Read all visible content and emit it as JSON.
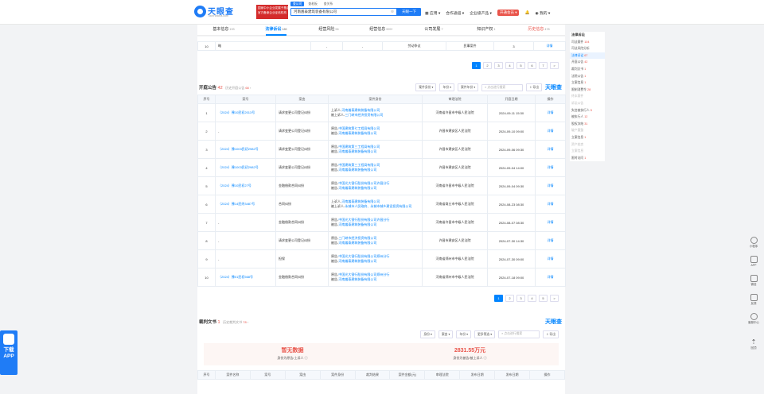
{
  "header": {
    "logo": {
      "cn": "天眼查",
      "en": "TianYancha.com"
    },
    "banner": [
      "国家中小企业发展子基金旗下",
      "官方备案企业征信机构"
    ],
    "search_tabs": [
      "查公司",
      "查老板",
      "查关系"
    ],
    "search_value": "河南嵩泰建筑装备有限公司",
    "search_button": "天眼一下",
    "nav": [
      "应用",
      "合作通道",
      "企业级产品",
      "开通会员",
      "防骗"
    ],
    "user": "我的"
  },
  "tabs": [
    {
      "label": "基本信息",
      "count": "193"
    },
    {
      "label": "法律诉讼",
      "count": "180"
    },
    {
      "label": "经营风险",
      "count": "96"
    },
    {
      "label": "经营信息",
      "count": "999+"
    },
    {
      "label": "公司发展",
      "count": "7"
    },
    {
      "label": "知识产权",
      "count": "1"
    },
    {
      "label": "历史信息",
      "count": "478"
    }
  ],
  "prev_row": {
    "no": "10",
    "c1": "略",
    "c2": "-",
    "c3": "-",
    "c4": "劳动争议",
    "c5": "民事案件",
    "c6": "3",
    "detail": "详情"
  },
  "pager1": [
    "1",
    "2",
    "3",
    "4",
    "5",
    "6",
    "7",
    ">"
  ],
  "kaiting": {
    "title": "开庭公告",
    "count": "42",
    "history_label": "历史开庭公告",
    "history_count": "68",
    "tools": [
      "案件身份 ▾",
      "年份 ▾",
      "案件年份 ▾",
      "点击进行搜索",
      "导出"
    ],
    "watermark": "天眼查",
    "headers": [
      "序号",
      "案号",
      "案由",
      "案件身份",
      "审理法院",
      "开庭日期",
      "操作"
    ],
    "rows": [
      {
        "no": "1",
        "case": "（2024）豫10民初2013号",
        "cause": "请求变更公司登记纠纷",
        "party": [
          "上诉人-河南嵩泰建筑装备有限公司",
          "被上诉人-三门峡市经济投资有限公司"
        ],
        "court": "河南省许昌市中级人民法院",
        "date": "2024-09-11 15:30",
        "op": "详情"
      },
      {
        "no": "2",
        "case": "-",
        "cause": "请求变更公司登记纠纷",
        "party": [
          "原告-中国建筑第七工程局有限公司",
          "被告-河南嵩泰建筑装备有限公司"
        ],
        "court": "许昌市建安区人民法院",
        "date": "2024-09-10 09:00",
        "op": "详情"
      },
      {
        "no": "3",
        "case": "（2024）豫1003民初2982号",
        "cause": "请求变更公司登记纠纷",
        "party": [
          "原告-中国建筑第三工程局有限公司",
          "被告-河南嵩泰建筑装备有限公司"
        ],
        "court": "许昌市建安区人民法院",
        "date": "2024-09-06 09:30",
        "op": "详情"
      },
      {
        "no": "4",
        "case": "（2024）豫1003民初2982号",
        "cause": "请求变更公司登记纠纷",
        "party": [
          "原告-中国建筑第三工程局有限公司",
          "被告-河南嵩泰建筑装备有限公司"
        ],
        "court": "许昌市建安区人民法院",
        "date": "2024-09-04 14:00",
        "op": "详情"
      },
      {
        "no": "5",
        "case": "（2024）豫10民初27号",
        "cause": "金融借款合同纠纷",
        "party": [
          "原告-中国光大银行股份有限公司许昌分行",
          "被告-河南嵩泰建筑装备有限公司"
        ],
        "court": "河南省许昌市中级人民法院",
        "date": "2024-09-04 09:30",
        "op": "详情"
      },
      {
        "no": "6",
        "case": "（2024）豫14民终3487号",
        "cause": "合同纠纷",
        "party": [
          "上诉人-河南嵩泰建筑装备有限公司",
          "被上诉人-永城市人民政府、永城市城乡建设投资有限公司"
        ],
        "court": "河南省商丘市中级人民法院",
        "date": "2024-08-23 08:30",
        "op": "详情"
      },
      {
        "no": "7",
        "case": "-",
        "cause": "金融借款合同纠纷",
        "party": [
          "原告-中国光大银行股份有限公司许昌分行",
          "被告-河南嵩泰建筑装备有限公司"
        ],
        "court": "河南省许昌市中级人民法院",
        "date": "2024-08-07 08:30",
        "op": "详情"
      },
      {
        "no": "8",
        "case": "-",
        "cause": "请求变更公司登记纠纷",
        "party": [
          "原告-三门峡市经济投资有限公司",
          "被告-河南嵩泰建筑装备有限公司"
        ],
        "court": "许昌市建安区人民法院",
        "date": "2024-07-30 14:30",
        "op": "详情"
      },
      {
        "no": "9",
        "case": "-",
        "cause": "担保",
        "party": [
          "原告-中国光大银行股份有限公司郑州分行",
          "被告-河南嵩泰建筑装备有限公司"
        ],
        "court": "河南省郑州市中级人民法院",
        "date": "2024-07-30 09:00",
        "op": "详情"
      },
      {
        "no": "10",
        "case": "（2024）豫01民初568号",
        "cause": "金融借款合同纠纷",
        "party": [
          "原告-中国光大银行股份有限公司郑州分行",
          "被告-河南嵩泰建筑装备有限公司"
        ],
        "court": "河南省郑州市中级人民法院",
        "date": "2024-07-18 09:00",
        "op": "详情"
      }
    ],
    "pager": [
      "1",
      "2",
      "3",
      "4",
      "5",
      ">"
    ]
  },
  "caipan": {
    "title": "裁判文书",
    "count": "1",
    "history_label": "历史裁判文书",
    "history_count": "78",
    "tools": [
      "身份 ▾",
      "案由 ▾",
      "年份 ▾",
      "更多筛选 ▾",
      "点击进行搜索",
      "导出"
    ],
    "watermark": "天眼查",
    "summary": [
      {
        "value": "暂无数据",
        "label": "身份为原告/上诉人"
      },
      {
        "value": "2831.55万元",
        "label": "身份为被告/被上诉人"
      }
    ],
    "headers": [
      "序号",
      "案件名称",
      "案号",
      "案由",
      "案件身份",
      "裁判结果",
      "案件金额(元)",
      "审理法院",
      "发布日期",
      "发布日期",
      "操作"
    ]
  },
  "right_panel": {
    "title": "法律诉讼",
    "items": [
      {
        "label": "司法案件",
        "count": "104"
      },
      {
        "label": "司法风险分析",
        "count": ""
      },
      {
        "label": "法律诉讼",
        "count": "67"
      },
      {
        "label": "开庭公告",
        "count": "42"
      },
      {
        "label": "裁判文书",
        "count": "1"
      },
      {
        "label": "法院公告",
        "count": "1"
      },
      {
        "label": "立案信息",
        "count": "1"
      },
      {
        "label": "限制消费令",
        "count": "28"
      },
      {
        "label": "终本案件",
        "count": ""
      },
      {
        "label": "诉讼公告",
        "count": ""
      },
      {
        "label": "失信被执行人",
        "count": "5"
      },
      {
        "label": "被执行人",
        "count": "12"
      },
      {
        "label": "股权冻结",
        "count": "31"
      },
      {
        "label": "破产重整",
        "count": ""
      },
      {
        "label": "立案信息",
        "count": "1"
      },
      {
        "label": "资产拍卖",
        "count": ""
      },
      {
        "label": "立案信息",
        "count": ""
      },
      {
        "label": "限时访问",
        "count": "1"
      }
    ]
  },
  "right_tools": [
    "小程序",
    "APP",
    "微信",
    "反馈",
    "客服中心",
    "回顶"
  ],
  "app_download": "下载APP"
}
